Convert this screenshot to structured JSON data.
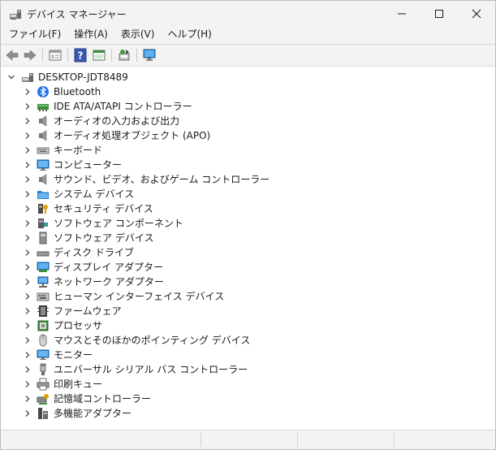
{
  "window": {
    "title": "デバイス マネージャー"
  },
  "menu": [
    {
      "label": "ファイル(F)"
    },
    {
      "label": "操作(A)"
    },
    {
      "label": "表示(V)"
    },
    {
      "label": "ヘルプ(H)"
    }
  ],
  "toolbar": {
    "buttons": [
      "back-arrow-icon",
      "forward-arrow-icon",
      "properties-icon",
      "help-icon",
      "view-icon",
      "scan-hardware-icon",
      "monitor-icon"
    ]
  },
  "tree": {
    "root": {
      "label": "DESKTOP-JDT8489",
      "expanded": true
    },
    "items": [
      {
        "label": "Bluetooth",
        "icon": "bluetooth-icon"
      },
      {
        "label": "IDE ATA/ATAPI コントローラー",
        "icon": "ide-controller-icon"
      },
      {
        "label": "オーディオの入力および出力",
        "icon": "speaker-icon"
      },
      {
        "label": "オーディオ処理オブジェクト (APO)",
        "icon": "speaker-icon"
      },
      {
        "label": "キーボード",
        "icon": "keyboard-icon"
      },
      {
        "label": "コンピューター",
        "icon": "computer-icon"
      },
      {
        "label": "サウンド、ビデオ、およびゲーム コントローラー",
        "icon": "speaker-icon"
      },
      {
        "label": "システム デバイス",
        "icon": "system-folder-icon"
      },
      {
        "label": "セキュリティ デバイス",
        "icon": "security-key-icon"
      },
      {
        "label": "ソフトウェア コンポーネント",
        "icon": "software-component-icon"
      },
      {
        "label": "ソフトウェア デバイス",
        "icon": "software-device-icon"
      },
      {
        "label": "ディスク ドライブ",
        "icon": "disk-drive-icon"
      },
      {
        "label": "ディスプレイ アダプター",
        "icon": "display-adapter-icon"
      },
      {
        "label": "ネットワーク アダプター",
        "icon": "network-adapter-icon"
      },
      {
        "label": "ヒューマン インターフェイス デバイス",
        "icon": "hid-icon"
      },
      {
        "label": "ファームウェア",
        "icon": "firmware-icon"
      },
      {
        "label": "プロセッサ",
        "icon": "processor-icon"
      },
      {
        "label": "マウスとそのほかのポインティング デバイス",
        "icon": "mouse-icon"
      },
      {
        "label": "モニター",
        "icon": "monitor-icon"
      },
      {
        "label": "ユニバーサル シリアル バス コントローラー",
        "icon": "usb-icon"
      },
      {
        "label": "印刷キュー",
        "icon": "printer-icon"
      },
      {
        "label": "記憶域コントローラー",
        "icon": "storage-controller-icon"
      },
      {
        "label": "多機能アダプター",
        "icon": "multifunction-adapter-icon"
      }
    ]
  },
  "colors": {
    "accent": "#0078d4",
    "bluetooth": "#1e73e8",
    "tree_bg": "#ffffff",
    "chrome_bg": "#f3f3f3"
  }
}
